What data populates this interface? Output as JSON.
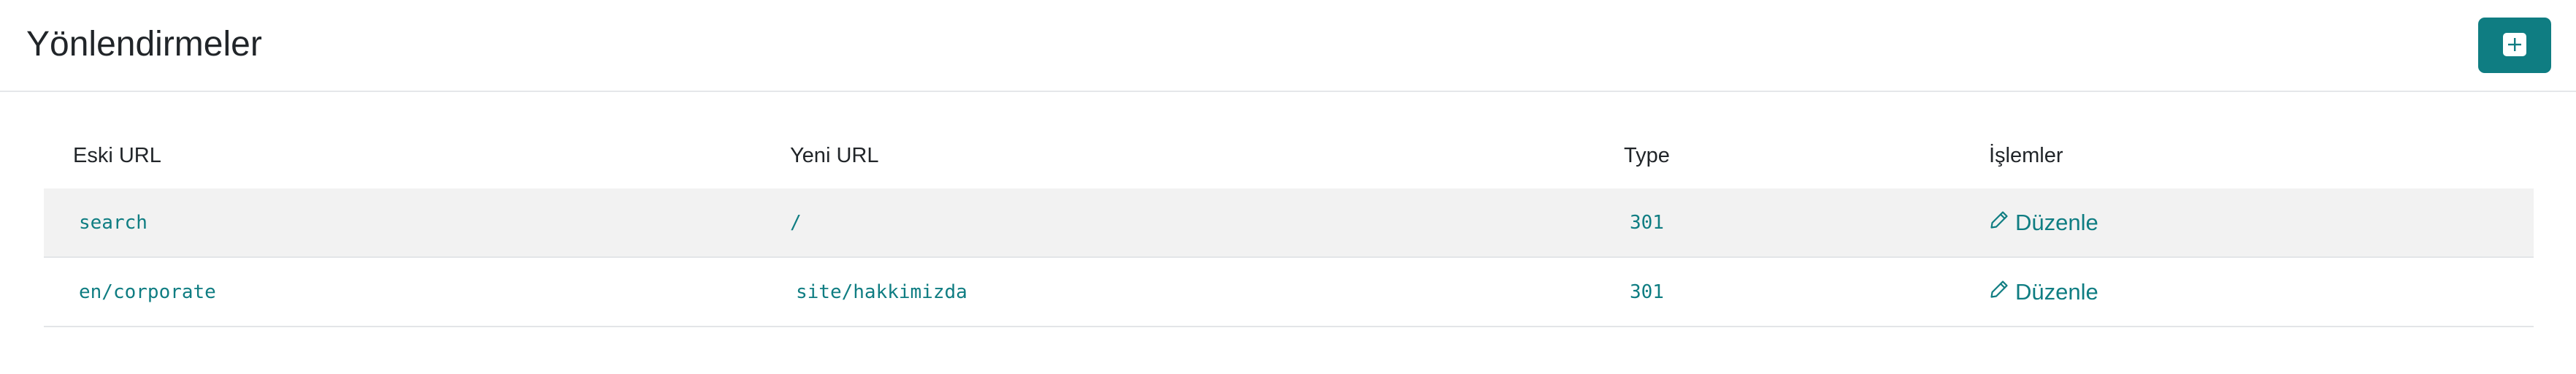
{
  "header": {
    "title": "Yönlendirmeler",
    "add_button_icon": "plus-square-icon",
    "accent_color": "#0f7d82"
  },
  "table": {
    "columns": [
      "Eski URL",
      "Yeni URL",
      "Type",
      "İşlemler"
    ],
    "rows": [
      {
        "old_url": "search",
        "new_url": "/",
        "type": "301",
        "action": "Düzenle"
      },
      {
        "old_url": "en/corporate",
        "new_url": "site/hakkimizda",
        "type": "301",
        "action": "Düzenle"
      }
    ],
    "edit_icon": "pencil-icon"
  }
}
